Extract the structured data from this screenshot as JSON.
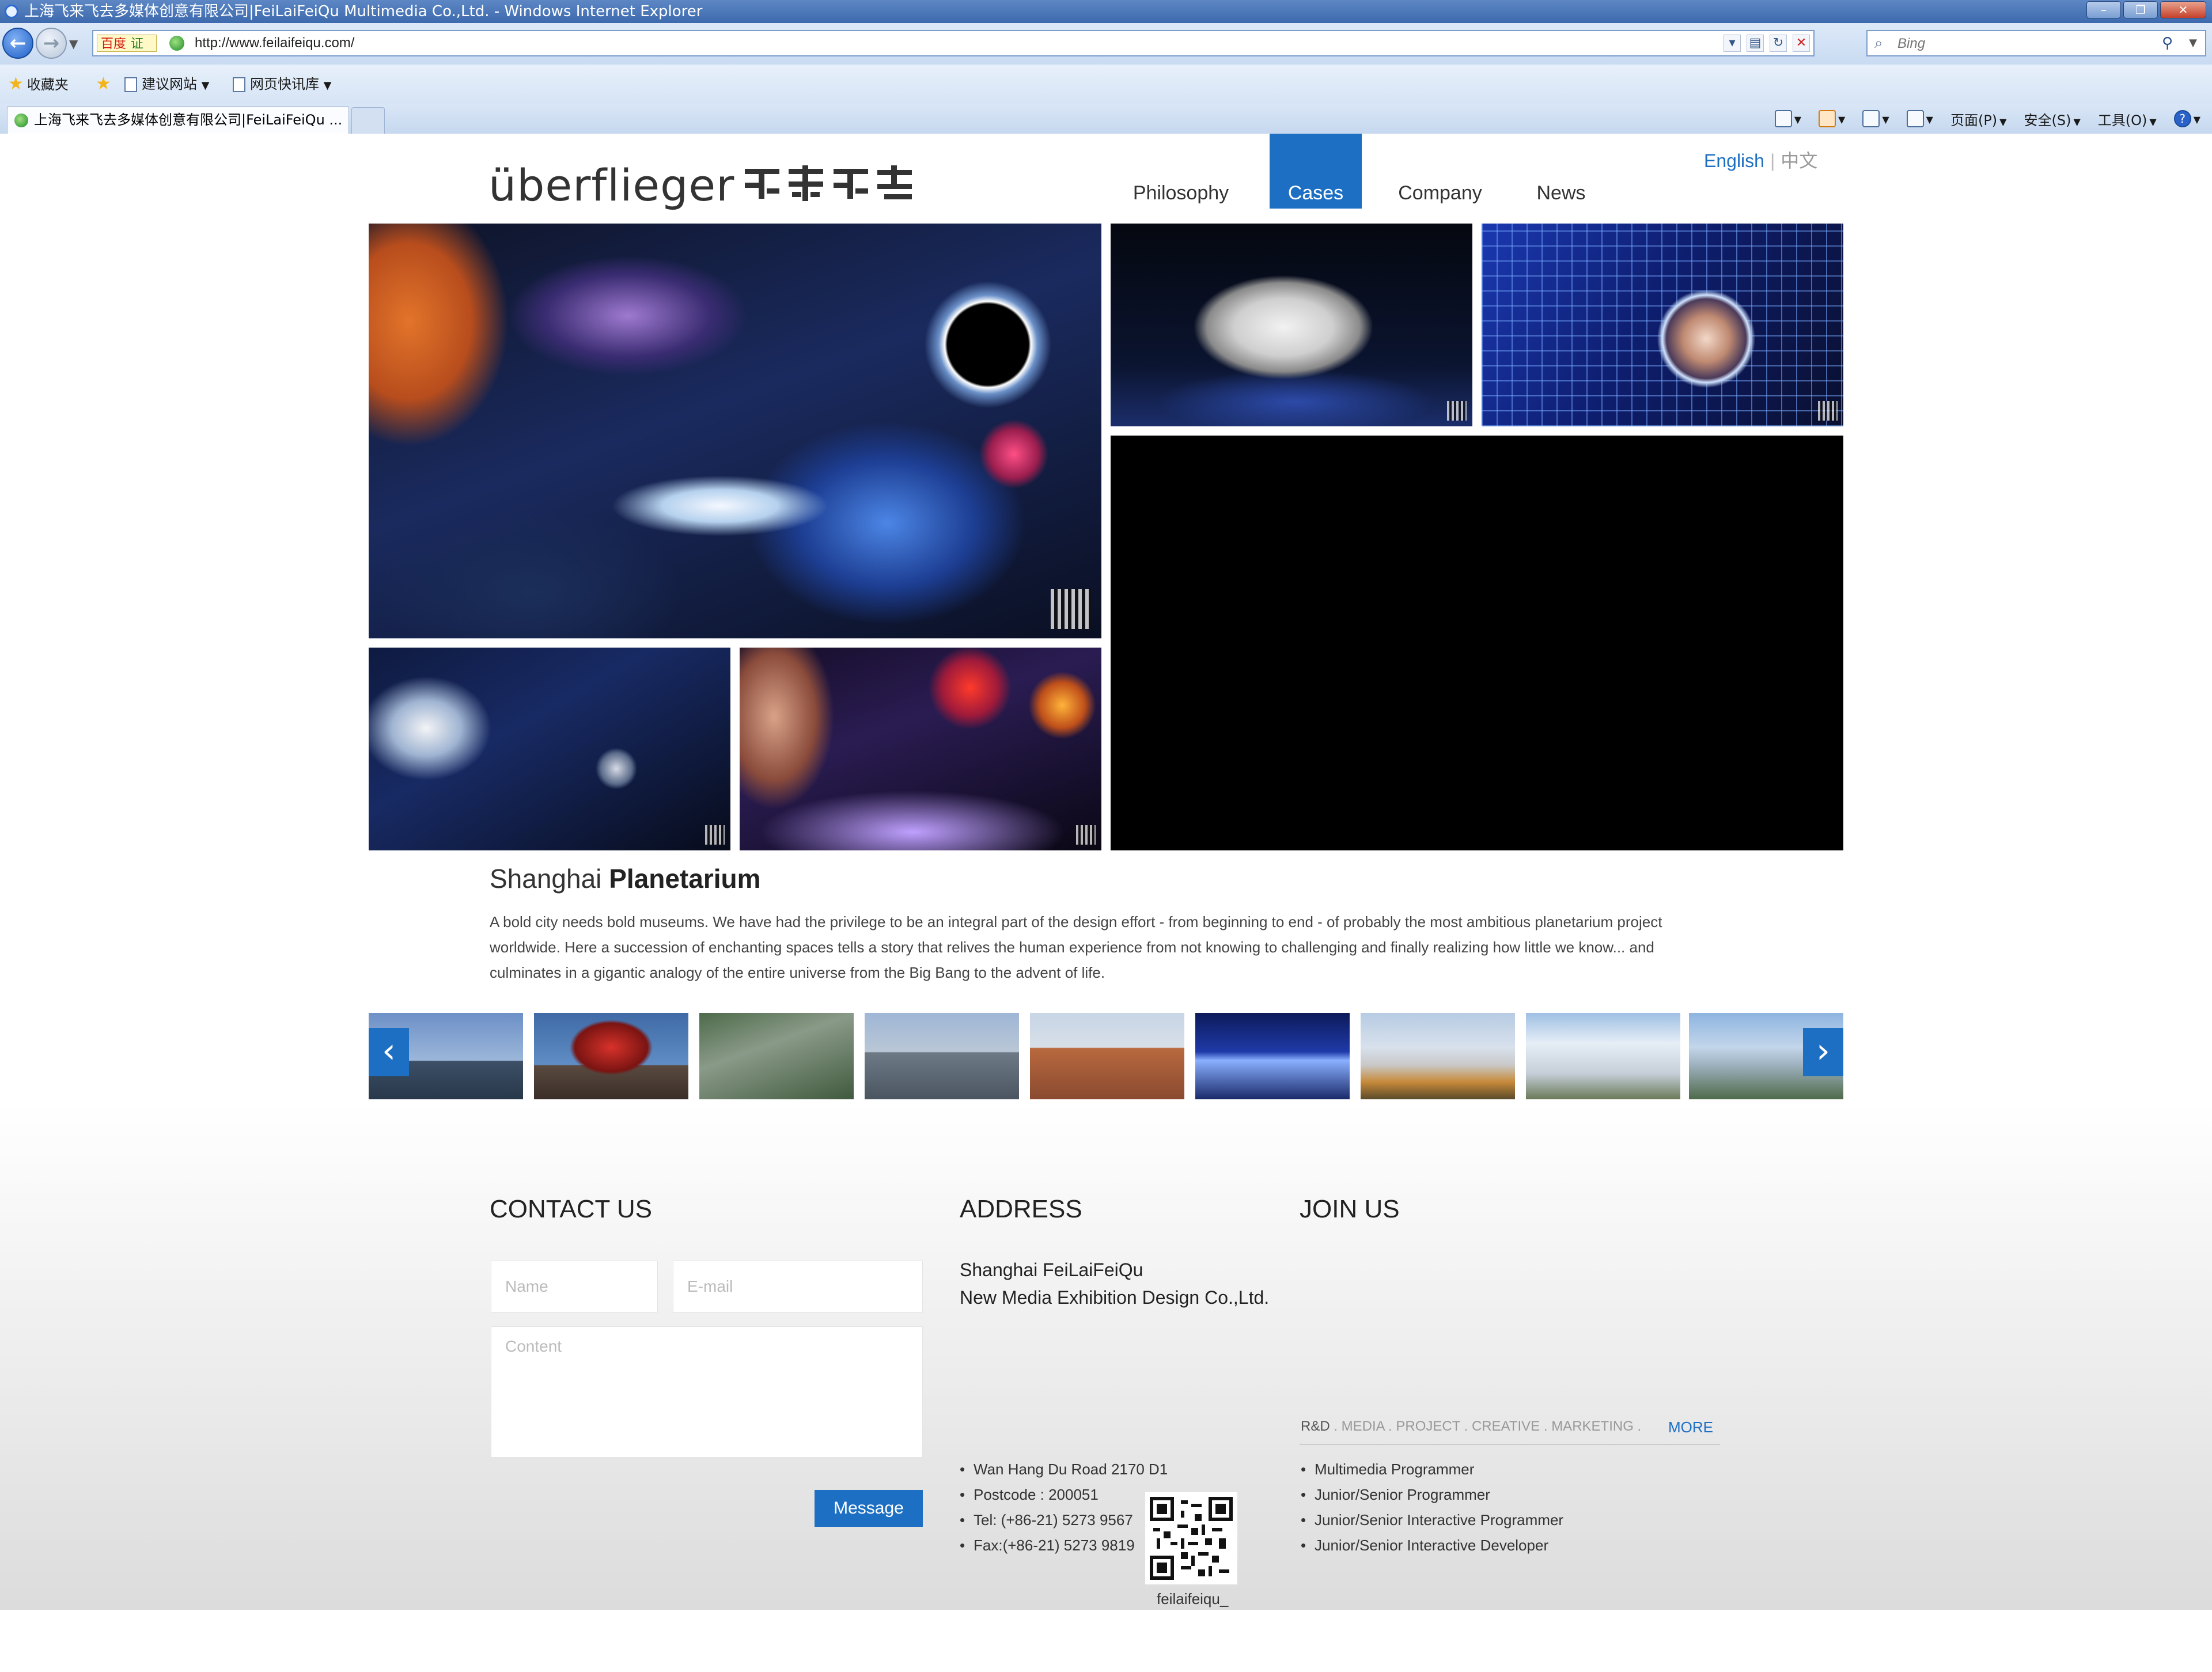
{
  "window": {
    "title": "上海飞来飞去多媒体创意有限公司|FeiLaiFeiQu Multimedia Co.,Ltd. - Windows Internet Explorer",
    "minimize_glyph": "–",
    "restore_glyph": "❐",
    "close_glyph": "✕"
  },
  "browser": {
    "badge_brand": "百度",
    "badge_cert": "证",
    "url": "http://www.feilaifeiqu.com/",
    "search_placeholder": "Bing",
    "favorites_label": "收藏夹",
    "fav_links": [
      "建议网站",
      "网页快讯库"
    ],
    "tab_title": "上海飞来飞去多媒体创意有限公司|FeiLaiFeiQu ...",
    "commands": {
      "page": "页面(P)",
      "safety": "安全(S)",
      "tools": "工具(O)"
    }
  },
  "site": {
    "logo_word": "überflieger",
    "logo_mark": "飞来飞去",
    "nav": [
      "Philosophy",
      "Cases",
      "Company",
      "News"
    ],
    "nav_active": "Cases",
    "lang_en": "English",
    "lang_sep": "|",
    "lang_cn": "中文",
    "case": {
      "title_light": "Shanghai",
      "title_bold": "Planetarium",
      "description": "A bold city needs bold museums. We have had the privilege to be an integral part of the design effort - from beginning to end - of probably the most ambitious planetarium project worldwide. Here a succession of enchanting spaces tells a story that relives the human experience from not knowing to challenging and finally realizing how little we know... and culminates in a gigantic analogy of the entire universe from the Big Bang to the advent of life."
    },
    "carousel": {
      "prev_glyph": "‹",
      "next_glyph": "›"
    },
    "contact": {
      "title": "CONTACT US",
      "name_placeholder": "Name",
      "email_placeholder": "E-mail",
      "content_placeholder": "Content",
      "button": "Message"
    },
    "address": {
      "title": "ADDRESS",
      "company_line1": "Shanghai FeiLaiFeiQu",
      "company_line2": "New Media Exhibition Design Co.,Ltd.",
      "lines": [
        "Wan Hang Du Road 2170 D1",
        "Postcode : 200051",
        "Tel: (+86-21) 5273 9567",
        "Fax:(+86-21) 5273 9819"
      ],
      "qr_caption": "feilaifeiqu_"
    },
    "join": {
      "title": "JOIN US",
      "tags_first": "R&D",
      "tags_rest": ". MEDIA . PROJECT . CREATIVE . MARKETING .",
      "more": "MORE",
      "jobs": [
        "Multimedia Programmer",
        "Junior/Senior Programmer",
        "Junior/Senior Interactive Programmer",
        "Junior/Senior Interactive Developer"
      ]
    },
    "accent_color": "#1d6fc4"
  }
}
